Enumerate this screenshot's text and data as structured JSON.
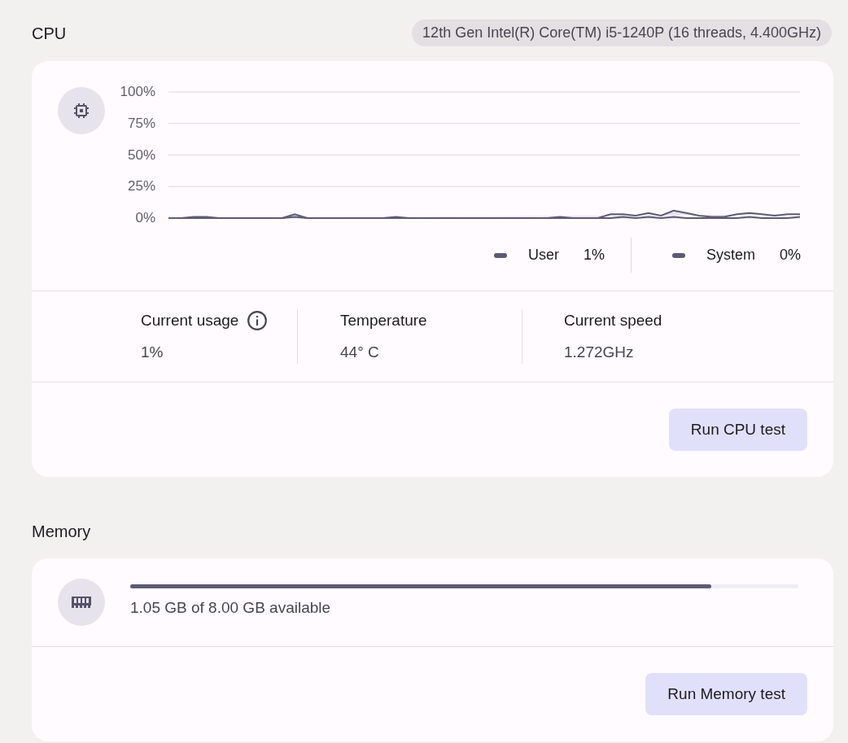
{
  "cpu": {
    "title": "CPU",
    "model": "12th Gen Intel(R) Core(TM) i5-1240P (16 threads, 4.400GHz)",
    "chart_data": {
      "type": "line",
      "grid": true,
      "ylim": [
        0,
        100
      ],
      "yticks": [
        {
          "value": 100,
          "label": "100%"
        },
        {
          "value": 75,
          "label": "75%"
        },
        {
          "value": 50,
          "label": "50%"
        },
        {
          "value": 25,
          "label": "25%"
        },
        {
          "value": 0,
          "label": "0%"
        }
      ],
      "series": [
        {
          "name": "User",
          "color": "#5d5b74",
          "values": [
            0,
            0,
            1,
            1,
            0,
            0,
            0,
            0,
            0,
            0,
            3,
            0,
            0,
            0,
            0,
            0,
            0,
            0,
            1,
            0,
            0,
            0,
            0,
            0,
            0,
            0,
            0,
            0,
            0,
            0,
            0,
            1,
            0,
            0,
            0,
            3,
            3,
            2,
            4,
            2,
            6,
            4,
            2,
            1,
            1,
            3,
            4,
            3,
            2,
            3,
            3
          ]
        },
        {
          "name": "System",
          "color": "#5d5b74",
          "values": [
            0,
            0,
            0,
            0,
            0,
            0,
            0,
            0,
            0,
            0,
            1,
            0,
            0,
            0,
            0,
            0,
            0,
            0,
            0,
            0,
            0,
            0,
            0,
            0,
            0,
            0,
            0,
            0,
            0,
            0,
            0,
            0,
            0,
            0,
            0,
            0,
            1,
            0,
            1,
            0,
            1,
            0,
            0,
            0,
            0,
            0,
            1,
            0,
            0,
            0,
            1
          ]
        }
      ]
    },
    "legend": [
      {
        "value": "1%"
      },
      {
        "value": "0%"
      }
    ],
    "stats": [
      {
        "label": "Current usage",
        "value": "1%",
        "info": true
      },
      {
        "label": "Temperature",
        "value": "44° C",
        "info": false
      },
      {
        "label": "Current speed",
        "value": "1.272GHz",
        "info": false
      }
    ],
    "button": "Run CPU test"
  },
  "memory": {
    "title": "Memory",
    "level": 0.87,
    "text": "1.05 GB of 8.00 GB available",
    "button": "Run Memory test"
  }
}
